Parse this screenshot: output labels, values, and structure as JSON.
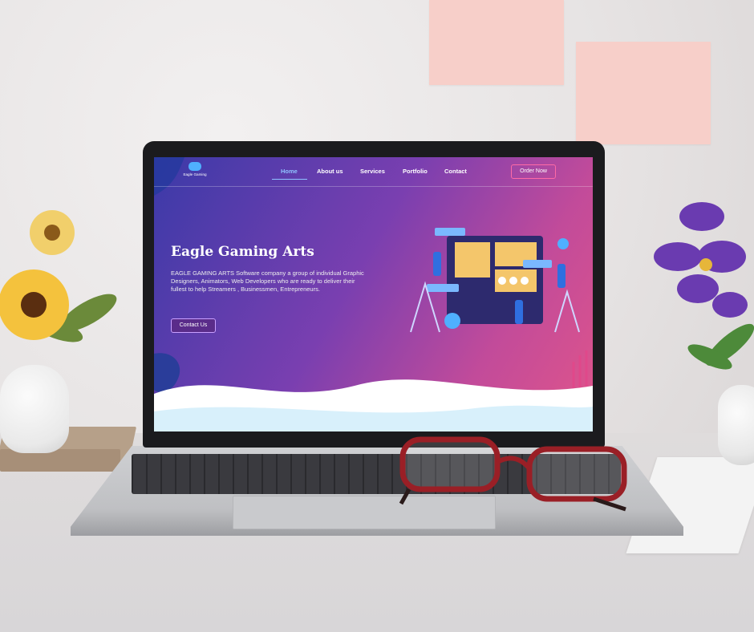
{
  "site": {
    "logo_text": "Eagle Gaming",
    "nav": [
      {
        "label": "Home",
        "active": true
      },
      {
        "label": "About us",
        "active": false
      },
      {
        "label": "Services",
        "active": false
      },
      {
        "label": "Portfolio",
        "active": false
      },
      {
        "label": "Contact",
        "active": false
      }
    ],
    "order_button": "Order Now",
    "hero": {
      "title": "Eagle Gaming Arts",
      "description": "EAGLE GAMING ARTS Software company  a group of individual Graphic Designers, Animators, Web Developers who are ready to deliver their fullest to help Streamers , Businessmen, Entrepreneurs.",
      "cta": "Contact Us"
    },
    "colors": {
      "gradient_start": "#3b3aa8",
      "gradient_end": "#e0558a",
      "nav_active": "#8fc2ff",
      "order_border": "#ff6aa6"
    }
  },
  "scene": {
    "objects": [
      "laptop",
      "sunflower-bouquet",
      "purple-orchid",
      "red-glasses",
      "sticky-notes",
      "book",
      "paper"
    ]
  }
}
